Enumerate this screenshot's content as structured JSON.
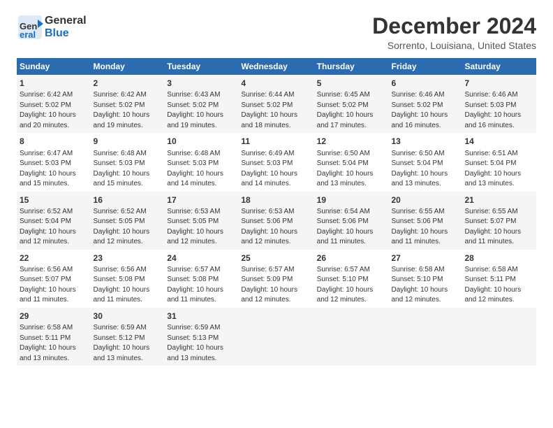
{
  "header": {
    "logo_line1": "General",
    "logo_line2": "Blue",
    "title": "December 2024",
    "subtitle": "Sorrento, Louisiana, United States"
  },
  "columns": [
    "Sunday",
    "Monday",
    "Tuesday",
    "Wednesday",
    "Thursday",
    "Friday",
    "Saturday"
  ],
  "weeks": [
    [
      {
        "day": "1",
        "info": "Sunrise: 6:42 AM\nSunset: 5:02 PM\nDaylight: 10 hours\nand 20 minutes."
      },
      {
        "day": "2",
        "info": "Sunrise: 6:42 AM\nSunset: 5:02 PM\nDaylight: 10 hours\nand 19 minutes."
      },
      {
        "day": "3",
        "info": "Sunrise: 6:43 AM\nSunset: 5:02 PM\nDaylight: 10 hours\nand 19 minutes."
      },
      {
        "day": "4",
        "info": "Sunrise: 6:44 AM\nSunset: 5:02 PM\nDaylight: 10 hours\nand 18 minutes."
      },
      {
        "day": "5",
        "info": "Sunrise: 6:45 AM\nSunset: 5:02 PM\nDaylight: 10 hours\nand 17 minutes."
      },
      {
        "day": "6",
        "info": "Sunrise: 6:46 AM\nSunset: 5:02 PM\nDaylight: 10 hours\nand 16 minutes."
      },
      {
        "day": "7",
        "info": "Sunrise: 6:46 AM\nSunset: 5:03 PM\nDaylight: 10 hours\nand 16 minutes."
      }
    ],
    [
      {
        "day": "8",
        "info": "Sunrise: 6:47 AM\nSunset: 5:03 PM\nDaylight: 10 hours\nand 15 minutes."
      },
      {
        "day": "9",
        "info": "Sunrise: 6:48 AM\nSunset: 5:03 PM\nDaylight: 10 hours\nand 15 minutes."
      },
      {
        "day": "10",
        "info": "Sunrise: 6:48 AM\nSunset: 5:03 PM\nDaylight: 10 hours\nand 14 minutes."
      },
      {
        "day": "11",
        "info": "Sunrise: 6:49 AM\nSunset: 5:03 PM\nDaylight: 10 hours\nand 14 minutes."
      },
      {
        "day": "12",
        "info": "Sunrise: 6:50 AM\nSunset: 5:04 PM\nDaylight: 10 hours\nand 13 minutes."
      },
      {
        "day": "13",
        "info": "Sunrise: 6:50 AM\nSunset: 5:04 PM\nDaylight: 10 hours\nand 13 minutes."
      },
      {
        "day": "14",
        "info": "Sunrise: 6:51 AM\nSunset: 5:04 PM\nDaylight: 10 hours\nand 13 minutes."
      }
    ],
    [
      {
        "day": "15",
        "info": "Sunrise: 6:52 AM\nSunset: 5:04 PM\nDaylight: 10 hours\nand 12 minutes."
      },
      {
        "day": "16",
        "info": "Sunrise: 6:52 AM\nSunset: 5:05 PM\nDaylight: 10 hours\nand 12 minutes."
      },
      {
        "day": "17",
        "info": "Sunrise: 6:53 AM\nSunset: 5:05 PM\nDaylight: 10 hours\nand 12 minutes."
      },
      {
        "day": "18",
        "info": "Sunrise: 6:53 AM\nSunset: 5:06 PM\nDaylight: 10 hours\nand 12 minutes."
      },
      {
        "day": "19",
        "info": "Sunrise: 6:54 AM\nSunset: 5:06 PM\nDaylight: 10 hours\nand 11 minutes."
      },
      {
        "day": "20",
        "info": "Sunrise: 6:55 AM\nSunset: 5:06 PM\nDaylight: 10 hours\nand 11 minutes."
      },
      {
        "day": "21",
        "info": "Sunrise: 6:55 AM\nSunset: 5:07 PM\nDaylight: 10 hours\nand 11 minutes."
      }
    ],
    [
      {
        "day": "22",
        "info": "Sunrise: 6:56 AM\nSunset: 5:07 PM\nDaylight: 10 hours\nand 11 minutes."
      },
      {
        "day": "23",
        "info": "Sunrise: 6:56 AM\nSunset: 5:08 PM\nDaylight: 10 hours\nand 11 minutes."
      },
      {
        "day": "24",
        "info": "Sunrise: 6:57 AM\nSunset: 5:08 PM\nDaylight: 10 hours\nand 11 minutes."
      },
      {
        "day": "25",
        "info": "Sunrise: 6:57 AM\nSunset: 5:09 PM\nDaylight: 10 hours\nand 12 minutes."
      },
      {
        "day": "26",
        "info": "Sunrise: 6:57 AM\nSunset: 5:10 PM\nDaylight: 10 hours\nand 12 minutes."
      },
      {
        "day": "27",
        "info": "Sunrise: 6:58 AM\nSunset: 5:10 PM\nDaylight: 10 hours\nand 12 minutes."
      },
      {
        "day": "28",
        "info": "Sunrise: 6:58 AM\nSunset: 5:11 PM\nDaylight: 10 hours\nand 12 minutes."
      }
    ],
    [
      {
        "day": "29",
        "info": "Sunrise: 6:58 AM\nSunset: 5:11 PM\nDaylight: 10 hours\nand 13 minutes."
      },
      {
        "day": "30",
        "info": "Sunrise: 6:59 AM\nSunset: 5:12 PM\nDaylight: 10 hours\nand 13 minutes."
      },
      {
        "day": "31",
        "info": "Sunrise: 6:59 AM\nSunset: 5:13 PM\nDaylight: 10 hours\nand 13 minutes."
      },
      {
        "day": "",
        "info": ""
      },
      {
        "day": "",
        "info": ""
      },
      {
        "day": "",
        "info": ""
      },
      {
        "day": "",
        "info": ""
      }
    ]
  ]
}
